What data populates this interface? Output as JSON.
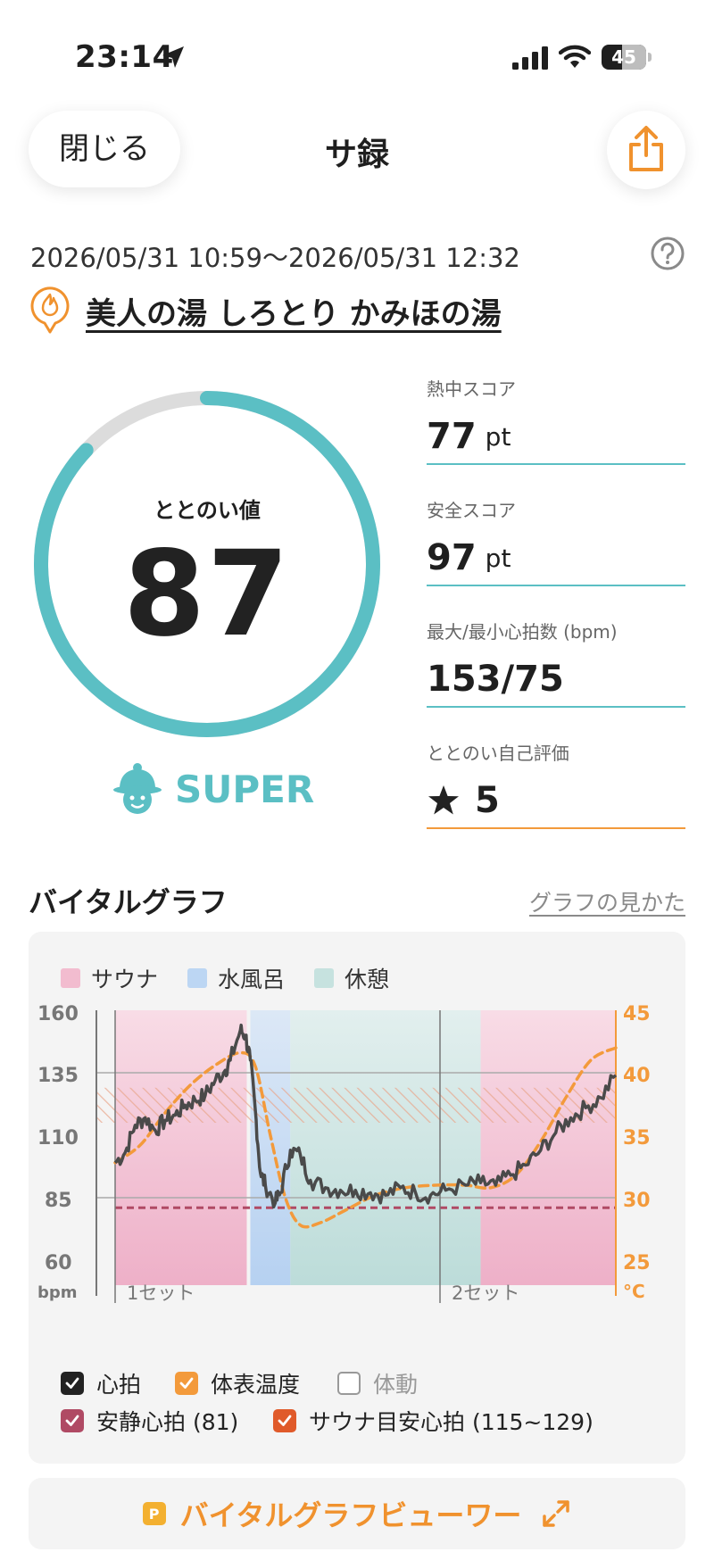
{
  "status_bar": {
    "time": "23:14",
    "battery_level": "45",
    "icons": [
      "location-arrow-icon",
      "signal-icon",
      "wifi-icon",
      "battery-icon"
    ]
  },
  "header": {
    "close_label": "閉じる",
    "title": "サ録",
    "share_icon": "share-icon"
  },
  "visit": {
    "datetime": "2026/05/31 10:59～2026/05/31 12:32",
    "facility_name": "美人の湯 しろとり かみほの湯",
    "help_icon": "help-circle-icon"
  },
  "score": {
    "label": "ととのい値",
    "value": "87",
    "ring_fraction": 0.87,
    "grade": "SUPER",
    "ring_color": "#5bbfc4"
  },
  "stats": [
    {
      "label": "熱中スコア",
      "value": "77",
      "unit": "pt"
    },
    {
      "label": "安全スコア",
      "value": "97",
      "unit": "pt"
    },
    {
      "label": "最大/最小心拍数 (bpm)",
      "value": "153/75",
      "unit": ""
    },
    {
      "label": "ととのい自己評価",
      "value": "5",
      "unit": ""
    }
  ],
  "vital_graph": {
    "title": "バイタルグラフ",
    "link_label": "グラフの見かた",
    "legend": [
      {
        "label": "サウナ",
        "color": "#f2bccf"
      },
      {
        "label": "水風呂",
        "color": "#bcd6f3"
      },
      {
        "label": "休憩",
        "color": "#c6e2df"
      }
    ],
    "left_axis": {
      "ticks": [
        "160",
        "135",
        "110",
        "85",
        "60"
      ],
      "unit": "bpm"
    },
    "right_axis": {
      "ticks": [
        "45",
        "40",
        "35",
        "30",
        "25"
      ],
      "unit": "°C"
    },
    "set_labels": [
      "1セット",
      "2セット"
    ],
    "checkboxes": [
      {
        "label": "心拍",
        "checked": true,
        "color": "#222222"
      },
      {
        "label": "体表温度",
        "checked": true,
        "color": "#f39a3b"
      },
      {
        "label": "体動",
        "checked": false,
        "color": "#999999"
      },
      {
        "label": "安静心拍 (81)",
        "checked": true,
        "color": "#b04a64"
      },
      {
        "label": "サウナ目安心拍 (115~129)",
        "checked": true,
        "color": "#e05a2a"
      }
    ]
  },
  "chart_data": {
    "type": "line",
    "ylim": [
      60,
      160
    ],
    "y2lim": [
      25,
      45
    ],
    "resting_hr": 81,
    "target_hr": [
      115,
      129
    ],
    "phases": [
      {
        "kind": "sauna",
        "from": 0,
        "to": 0.27
      },
      {
        "kind": "cold-bath",
        "from": 0.27,
        "to": 0.35
      },
      {
        "kind": "rest",
        "from": 0.35,
        "to": 0.73
      },
      {
        "kind": "sauna",
        "from": 0.73,
        "to": 1.0
      }
    ],
    "series": [
      {
        "name": "心拍",
        "color": "#4a4a4a",
        "points": [
          [
            0,
            99
          ],
          [
            0.02,
            103
          ],
          [
            0.04,
            114
          ],
          [
            0.06,
            117
          ],
          [
            0.08,
            112
          ],
          [
            0.1,
            116
          ],
          [
            0.12,
            118
          ],
          [
            0.14,
            122
          ],
          [
            0.16,
            124
          ],
          [
            0.18,
            126
          ],
          [
            0.2,
            132
          ],
          [
            0.22,
            136
          ],
          [
            0.23,
            140
          ],
          [
            0.25,
            152
          ],
          [
            0.26,
            150
          ],
          [
            0.27,
            140
          ],
          [
            0.28,
            120
          ],
          [
            0.29,
            95
          ],
          [
            0.3,
            90
          ],
          [
            0.32,
            83
          ],
          [
            0.33,
            87
          ],
          [
            0.35,
            104
          ],
          [
            0.37,
            102
          ],
          [
            0.39,
            92
          ],
          [
            0.42,
            89
          ],
          [
            0.45,
            88
          ],
          [
            0.48,
            88
          ],
          [
            0.51,
            87
          ],
          [
            0.54,
            86
          ],
          [
            0.57,
            89
          ],
          [
            0.6,
            87
          ],
          [
            0.63,
            86
          ],
          [
            0.66,
            88
          ],
          [
            0.7,
            90
          ],
          [
            0.73,
            91
          ],
          [
            0.76,
            90
          ],
          [
            0.79,
            94
          ],
          [
            0.82,
            98
          ],
          [
            0.85,
            104
          ],
          [
            0.88,
            111
          ],
          [
            0.91,
            117
          ],
          [
            0.94,
            121
          ],
          [
            0.97,
            125
          ],
          [
            1.0,
            134
          ]
        ]
      },
      {
        "name": "体表温度",
        "color": "#f39a3b",
        "points": [
          [
            0,
            32.8
          ],
          [
            0.05,
            34.2
          ],
          [
            0.1,
            36.8
          ],
          [
            0.15,
            39
          ],
          [
            0.2,
            40.6
          ],
          [
            0.25,
            41.6
          ],
          [
            0.28,
            40.5
          ],
          [
            0.31,
            35
          ],
          [
            0.34,
            30
          ],
          [
            0.37,
            27.8
          ],
          [
            0.41,
            28
          ],
          [
            0.46,
            29
          ],
          [
            0.52,
            30.2
          ],
          [
            0.58,
            30.8
          ],
          [
            0.64,
            31
          ],
          [
            0.7,
            31
          ],
          [
            0.75,
            30.8
          ],
          [
            0.8,
            31.8
          ],
          [
            0.85,
            34.5
          ],
          [
            0.9,
            38
          ],
          [
            0.95,
            41
          ],
          [
            1.0,
            42
          ]
        ]
      }
    ]
  }
}
